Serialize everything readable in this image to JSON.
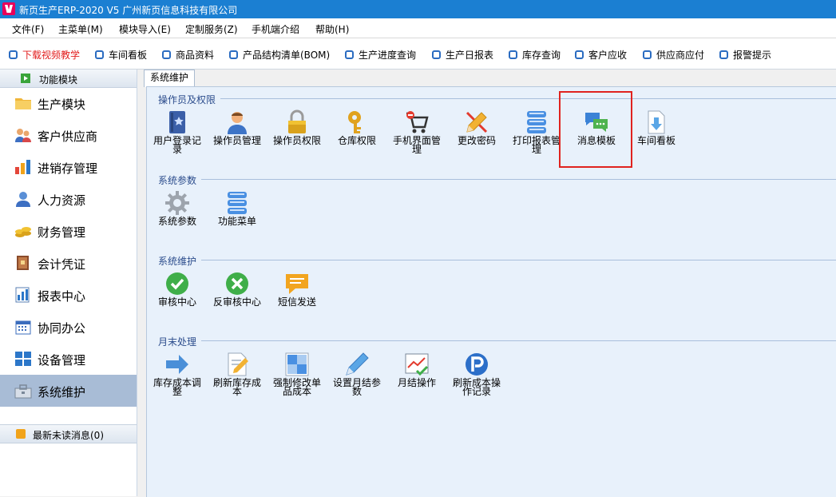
{
  "window": {
    "title": "新页生产ERP-2020 V5 广州新页信息科技有限公司"
  },
  "menu": [
    "文件(F)",
    "主菜单(M)",
    "模块导入(E)",
    "定制服务(Z)",
    "手机端介绍",
    "帮助(H)"
  ],
  "toolbar": [
    "下载视频教学",
    "车间看板",
    "商品资料",
    "产品结构清单(BOM)",
    "生产进度查询",
    "生产日报表",
    "库存查询",
    "客户应收",
    "供应商应付",
    "报警提示"
  ],
  "sidebar": {
    "header": "功能模块",
    "items": [
      "生产模块",
      "客户供应商",
      "进销存管理",
      "人力资源",
      "财务管理",
      "会计凭证",
      "报表中心",
      "协同办公",
      "设备管理",
      "系统维护"
    ],
    "active": "系统维护",
    "footer": "最新未读消息(0)"
  },
  "tab": "系统维护",
  "groups": [
    {
      "title": "操作员及权限",
      "items": [
        "用户登录记录",
        "操作员管理",
        "操作员权限",
        "仓库权限",
        "手机界面管理",
        "更改密码",
        "打印报表管理",
        "消息模板",
        "车间看板"
      ]
    },
    {
      "title": "系统参数",
      "items": [
        "系统参数",
        "功能菜单"
      ]
    },
    {
      "title": "系统维护",
      "items": [
        "审核中心",
        "反审核中心",
        "短信发送"
      ]
    },
    {
      "title": "月末处理",
      "items": [
        "库存成本调整",
        "刷新库存成本",
        "强制修改单品成本",
        "设置月结参数",
        "月结操作",
        "刷新成本操作记录"
      ]
    }
  ],
  "highlighted": "消息模板",
  "colors": {
    "titlebar": "#1b7fd2",
    "panel": "#e8f1fb",
    "highlight": "#e0231f",
    "active_sidebar": "#a8bcd6"
  }
}
